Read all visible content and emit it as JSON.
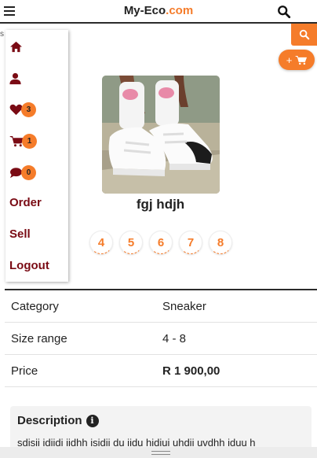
{
  "header": {
    "brand_part1": "My-Eco",
    "brand_part2": ".com"
  },
  "stray_text": "s",
  "floating": {
    "add_cart_label": "+"
  },
  "menu": {
    "items": [
      {
        "icon": "home-icon"
      },
      {
        "icon": "user-icon"
      },
      {
        "icon": "heart-icon",
        "badge": "3"
      },
      {
        "icon": "cart-icon",
        "badge": "1"
      },
      {
        "icon": "chat-icon",
        "badge": "0"
      },
      {
        "label": "Order"
      },
      {
        "label": "Sell"
      },
      {
        "label": "Logout"
      }
    ]
  },
  "product": {
    "name": "fgj hdjh",
    "sizes": [
      "4",
      "5",
      "6",
      "7",
      "8"
    ]
  },
  "details": [
    {
      "key": "Category",
      "value": "Sneaker"
    },
    {
      "key": "Size range",
      "value": "4 - 8"
    },
    {
      "key": "Price",
      "value": "R 1 900,00"
    }
  ],
  "description": {
    "title": "Description",
    "text": "sdisii idiidi iidhh isidii du iidu hidiui uhdii uvdhh iduu h"
  },
  "colors": {
    "accent": "#f57c2a",
    "menu_text": "#7a0b14"
  }
}
